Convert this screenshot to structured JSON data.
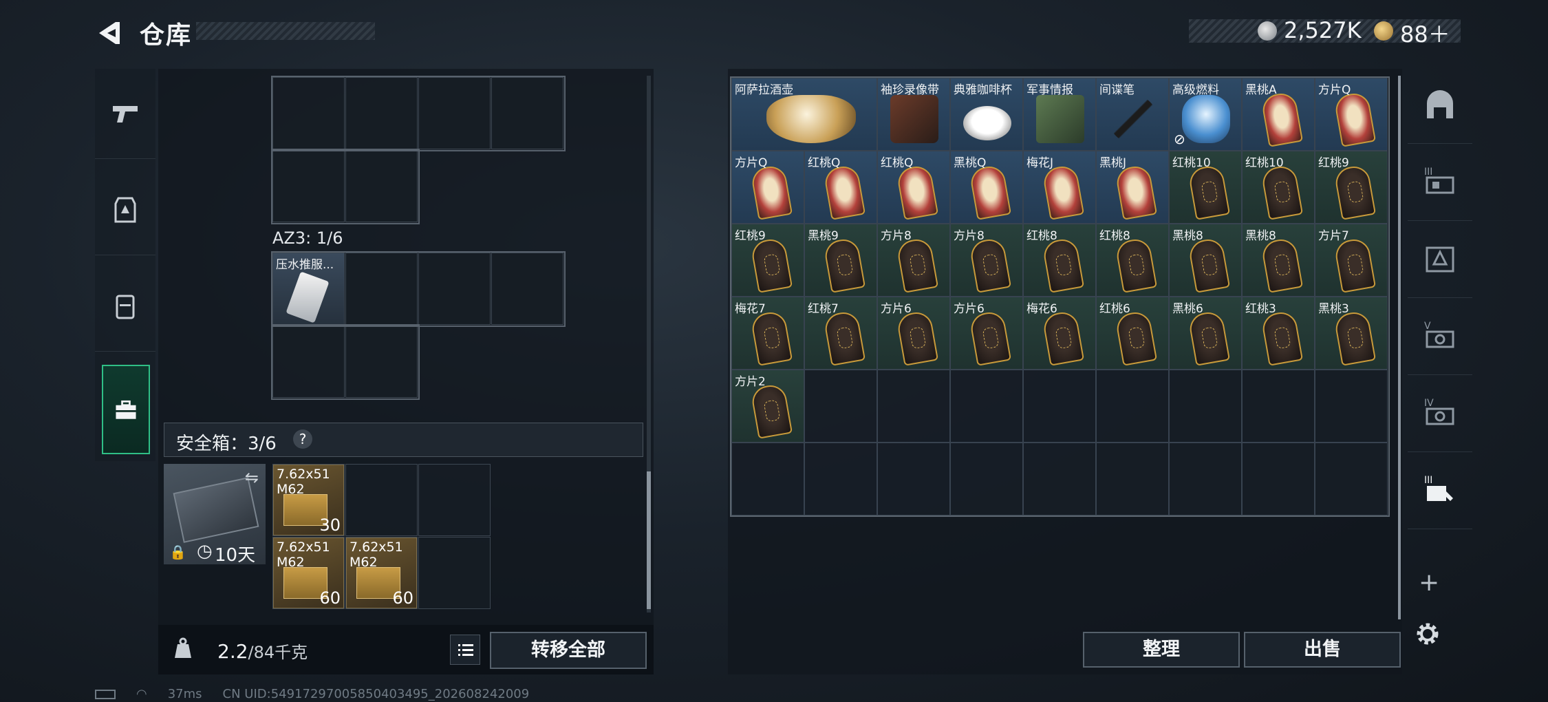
{
  "header": {
    "title": "仓库",
    "currency_amount": "2,527K",
    "premium_amount": "88＋"
  },
  "left_tabs": [
    {
      "icon": "pistol-icon"
    },
    {
      "icon": "armor-vest-icon"
    },
    {
      "icon": "backpack-icon"
    },
    {
      "icon": "briefcase-icon",
      "active": true
    }
  ],
  "left_panel": {
    "az3_label": "AZ3: 1/6",
    "az3_item": "压水推服...",
    "safe_box_label": "安全箱：3/6",
    "help": "?",
    "safe_case_days": "10天",
    "ammo": [
      {
        "name": "7.62x51\nM62",
        "count": "30"
      },
      {
        "name": "7.62x51\nM62",
        "count": "60"
      },
      {
        "name": "7.62x51\nM62",
        "count": "60"
      }
    ],
    "weight_current": "2.2",
    "weight_max": "/84千克",
    "transfer_all": "转移全部"
  },
  "stash": {
    "row1": [
      {
        "name": "阿萨拉酒壶",
        "type": "item-pot",
        "bg": "blue",
        "wide": true
      },
      {
        "name": "袖珍录像带",
        "type": "item-tape",
        "bg": "blue"
      },
      {
        "name": "典雅咖啡杯",
        "type": "item-cup",
        "bg": "blue"
      },
      {
        "name": "军事情报",
        "type": "item-intel",
        "bg": "blue"
      },
      {
        "name": "间谍笔",
        "type": "item-pen",
        "bg": "blue"
      },
      {
        "name": "高级燃料",
        "type": "item-fuel",
        "bg": "blue"
      },
      {
        "name": "黑桃A",
        "type": "face",
        "bg": "blue"
      },
      {
        "name": "方片Q",
        "type": "face",
        "bg": "blue"
      }
    ],
    "row2": [
      {
        "name": "方片Q",
        "type": "face",
        "bg": "blue"
      },
      {
        "name": "红桃Q",
        "type": "face",
        "bg": "blue"
      },
      {
        "name": "红桃Q",
        "type": "face",
        "bg": "blue"
      },
      {
        "name": "黑桃Q",
        "type": "face",
        "bg": "blue"
      },
      {
        "name": "梅花J",
        "type": "face",
        "bg": "blue"
      },
      {
        "name": "黑桃J",
        "type": "face",
        "bg": "blue"
      },
      {
        "name": "红桃10",
        "type": "dark",
        "bg": "green"
      },
      {
        "name": "红桃10",
        "type": "dark",
        "bg": "green"
      },
      {
        "name": "红桃9",
        "type": "dark",
        "bg": "green"
      }
    ],
    "row3": [
      {
        "name": "红桃9",
        "type": "dark",
        "bg": "green"
      },
      {
        "name": "黑桃9",
        "type": "dark",
        "bg": "green"
      },
      {
        "name": "方片8",
        "type": "dark",
        "bg": "green"
      },
      {
        "name": "方片8",
        "type": "dark",
        "bg": "green"
      },
      {
        "name": "红桃8",
        "type": "dark",
        "bg": "green"
      },
      {
        "name": "红桃8",
        "type": "dark",
        "bg": "green"
      },
      {
        "name": "黑桃8",
        "type": "dark",
        "bg": "green"
      },
      {
        "name": "黑桃8",
        "type": "dark",
        "bg": "green"
      },
      {
        "name": "方片7",
        "type": "dark",
        "bg": "green"
      }
    ],
    "row4": [
      {
        "name": "梅花7",
        "type": "dark",
        "bg": "green"
      },
      {
        "name": "红桃7",
        "type": "dark",
        "bg": "green"
      },
      {
        "name": "方片6",
        "type": "dark",
        "bg": "green"
      },
      {
        "name": "方片6",
        "type": "dark",
        "bg": "green"
      },
      {
        "name": "梅花6",
        "type": "dark",
        "bg": "green"
      },
      {
        "name": "红桃6",
        "type": "dark",
        "bg": "green"
      },
      {
        "name": "黑桃6",
        "type": "dark",
        "bg": "green"
      },
      {
        "name": "红桃3",
        "type": "dark",
        "bg": "green"
      },
      {
        "name": "黑桃3",
        "type": "dark",
        "bg": "green"
      }
    ],
    "row5": [
      {
        "name": "方片2",
        "type": "dark",
        "bg": "green"
      }
    ],
    "sort_label": "整理",
    "sell_label": "出售"
  },
  "right_tabs": [
    {
      "icon": "stash-home-icon",
      "label": ""
    },
    {
      "icon": "tier-3-container-icon",
      "label": "III"
    },
    {
      "icon": "container-icon",
      "label": ""
    },
    {
      "icon": "tier-5-container-icon",
      "label": "V"
    },
    {
      "icon": "tier-4-container-icon",
      "label": "IV"
    },
    {
      "icon": "tier-3-tools-icon",
      "label": "III"
    }
  ],
  "status_bar": {
    "ping": "37ms",
    "uid": "CN UID:54917297005850403495_202608242009"
  },
  "colors": {
    "accent_green": "#3dd69a",
    "rare_blue": "#2e4a66",
    "card_green": "#28403b"
  }
}
